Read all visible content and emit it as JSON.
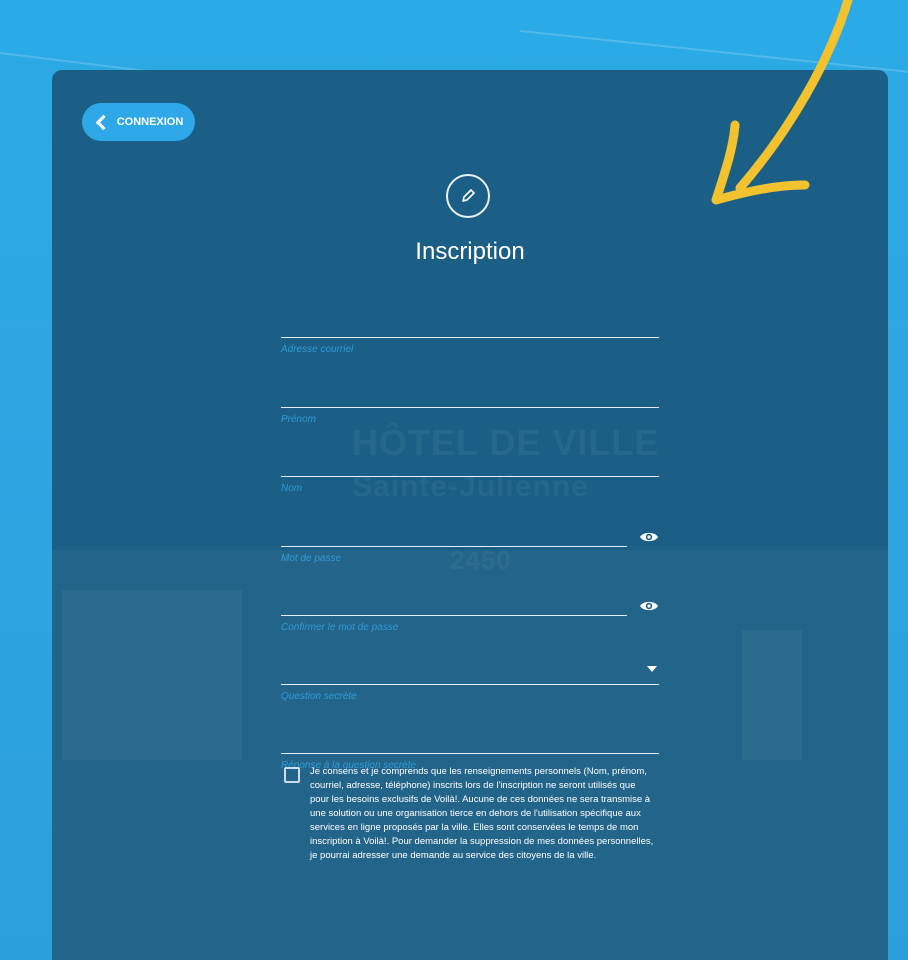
{
  "back_button": {
    "label": "CONNEXION"
  },
  "form": {
    "title": "Inscription",
    "fields": [
      {
        "label": "Adresse courriel"
      },
      {
        "label": "Prénom"
      },
      {
        "label": "Nom"
      },
      {
        "label": "Mot de passe"
      },
      {
        "label": "Confirmer le mot de passe"
      },
      {
        "label": "Question secrète"
      },
      {
        "label": "Réponse à la question secrète"
      }
    ],
    "consent_text": "Je consens et je comprends que les renseignements personnels (Nom, prénom, courriel, adresse, téléphone) inscrits lors de l'inscription ne seront utilisés que pour les besoins exclusifs de Voilà!. Aucune de ces données ne sera transmise à une solution ou une organisation tierce en dehors de l'utilisation spécifique aux services en ligne proposés par la ville. Elles sont conservées le temps de mon inscription à Voilà!. Pour demander la suppression de mes données personnelles, je pourrai adresser une demande au service des citoyens de la ville."
  },
  "background": {
    "sign_line1": "HÔTEL DE VILLE",
    "sign_line2": "Sainte-Julienne",
    "sign_number": "2450"
  },
  "colors": {
    "page_background": "#2aaae6",
    "panel": "#1b5f86",
    "accent": "#2ea8e8",
    "arrow": "#f2c22f",
    "field_label": "#2f9ad6"
  },
  "icons": {
    "back": "chevron-left-icon",
    "title": "pencil-icon",
    "password_toggle": "eye-icon",
    "select": "caret-down-icon"
  }
}
